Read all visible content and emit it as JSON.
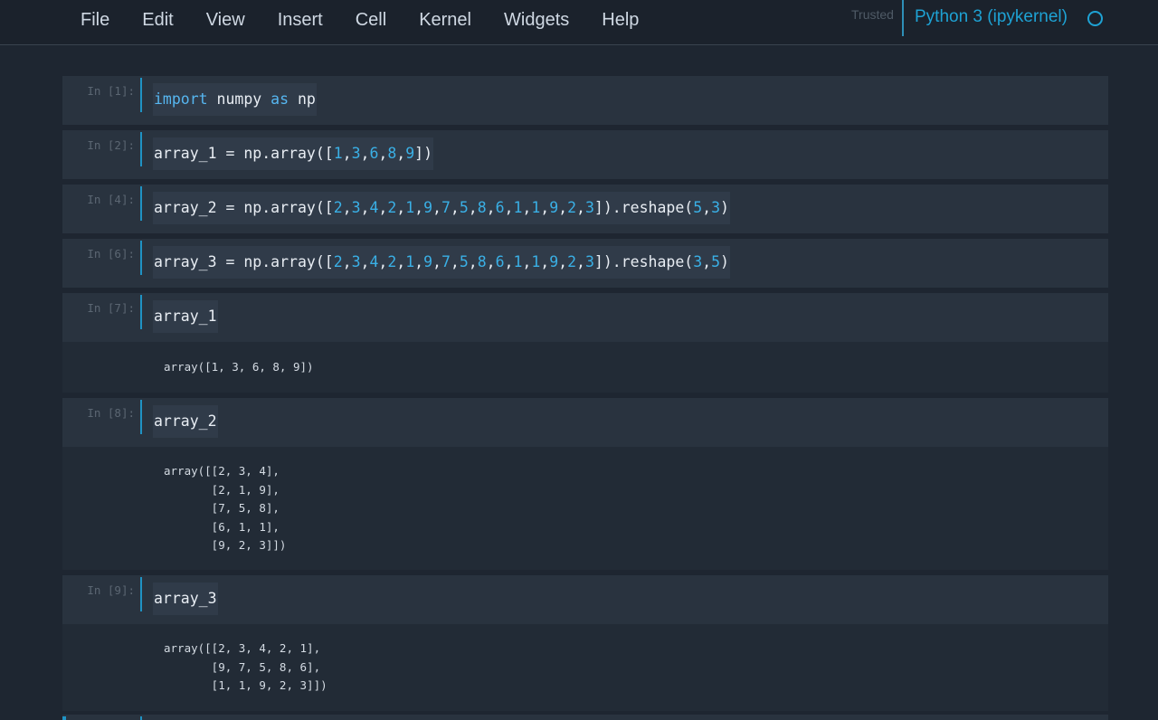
{
  "menubar": {
    "items": [
      "File",
      "Edit",
      "View",
      "Insert",
      "Cell",
      "Kernel",
      "Widgets",
      "Help"
    ],
    "trusted": "Trusted",
    "kernel_name": "Python 3 (ipykernel)"
  },
  "cells": [
    {
      "prompt": "In [1]:",
      "code": "import numpy as np"
    },
    {
      "prompt": "In [2]:",
      "code": "array_1 = np.array([1,3,6,8,9])"
    },
    {
      "prompt": "In [4]:",
      "code": "array_2 = np.array([2,3,4,2,1,9,7,5,8,6,1,1,9,2,3]).reshape(5,3)"
    },
    {
      "prompt": "In [6]:",
      "code": "array_3 = np.array([2,3,4,2,1,9,7,5,8,6,1,1,9,2,3]).reshape(3,5)"
    },
    {
      "prompt": "In [7]:",
      "code": "array_1",
      "output": "array([1, 3, 6, 8, 9])"
    },
    {
      "prompt": "In [8]:",
      "code": "array_2",
      "output": "array([[2, 3, 4],\n       [2, 1, 9],\n       [7, 5, 8],\n       [6, 1, 1],\n       [9, 2, 3]])"
    },
    {
      "prompt": "In [9]:",
      "code": "array_3",
      "output": "array([[2, 3, 4, 2, 1],\n       [9, 7, 5, 8, 6],\n       [1, 1, 9, 2, 3]])"
    }
  ],
  "colors": {
    "accent": "#1ea2d4",
    "keyword": "#56b6f0",
    "number": "#3ab0e6",
    "background": "#1e2631",
    "cell_background": "#29333f"
  }
}
